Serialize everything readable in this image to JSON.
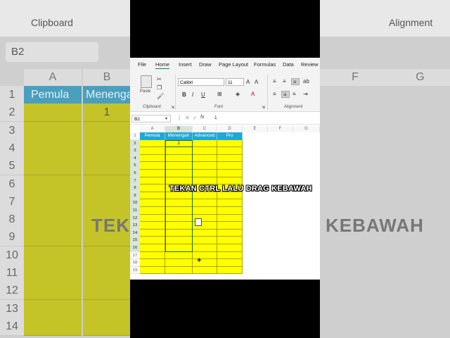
{
  "background": {
    "clipboard_label": "Clipboard",
    "alignment_label": "Alignment",
    "name_box": "B2",
    "col_headers": [
      "A",
      "B",
      "F",
      "G"
    ],
    "row_numbers": [
      "1",
      "2",
      "3",
      "4",
      "5",
      "6",
      "7",
      "8",
      "9",
      "10",
      "11",
      "12",
      "13",
      "14"
    ],
    "header_a": "Pemula",
    "header_b": "Menengah",
    "cell_b2": "1",
    "big_left": "TEK",
    "big_right": "KEBAWAH"
  },
  "menu": {
    "items": [
      "File",
      "Home",
      "Insert",
      "Draw",
      "Page Layout",
      "Formulas",
      "Data",
      "Review"
    ]
  },
  "ribbon": {
    "paste_label": "Paste",
    "clipboard_label": "Clipboard",
    "font_name": "Calibri",
    "font_size": "11",
    "font_label": "Font",
    "alignment_label": "Alignment",
    "bold": "B",
    "italic": "I",
    "underline": "U"
  },
  "formula_bar": {
    "name_box": "B2",
    "fx": "fx",
    "value": "1"
  },
  "grid": {
    "col_headers": [
      "A",
      "B",
      "C",
      "D",
      "E",
      "F",
      "G"
    ],
    "row_numbers": [
      "1",
      "2",
      "3",
      "4",
      "5",
      "6",
      "7",
      "8",
      "9",
      "10",
      "11",
      "12",
      "13",
      "14",
      "15",
      "16",
      "17",
      "18",
      "19"
    ],
    "headers": [
      "Pemula",
      "Menengah",
      "Advanced",
      "Pro"
    ],
    "b2_value": "1"
  },
  "caption": "TEKAN CTRL LALU DRAG KEBAWAH",
  "colors": {
    "header_blue": "#1fa7d6",
    "cell_yellow": "#ffff00",
    "excel_green": "#107c41"
  }
}
